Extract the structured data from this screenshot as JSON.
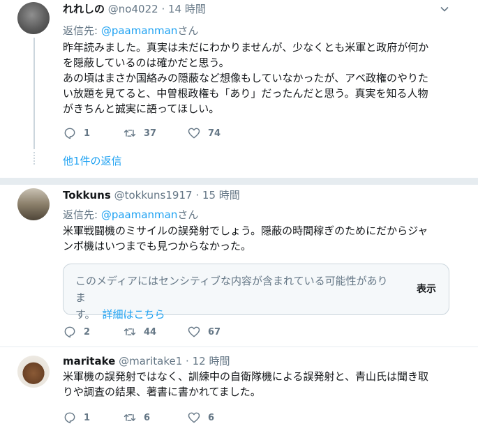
{
  "tweets": [
    {
      "name": "れれしの",
      "handle": "@no4022",
      "separator": "·",
      "time": "14 時間",
      "reply_prefix": "返信先: ",
      "reply_mention": "@paamanman",
      "reply_suffix": "さん",
      "lines": [
        "昨年読みました。真実は未だにわかりませんが、少なくとも米軍と政府が何か",
        "を隠蔽しているのは確かだと思う。",
        "あの頃はまさか国絡みの隠蔽など想像もしていなかったが、アベ政権のやりた",
        "い放題を見てると、中曽根政権も「あり」だったんだと思う。真実を知る人物",
        "がきちんと誠実に語ってほしい。"
      ],
      "replies": "1",
      "retweets": "37",
      "likes": "74",
      "more_replies": "他1件の返信"
    },
    {
      "name": "Tokkuns",
      "handle": "@tokkuns1917",
      "separator": "·",
      "time": "15 時間",
      "reply_prefix": "返信先: ",
      "reply_mention": "@paamanman",
      "reply_suffix": "さん",
      "lines": [
        "米軍戦闘機のミサイルの誤発射でしょう。隠蔽の時間稼ぎのためにだからジャ",
        "ンボ機はいつまでも見つからなかった。"
      ],
      "sensitive": {
        "line1": "このメディアにはセンシティブな内容が含まれている可能性がありま",
        "line2": "す。",
        "link": "詳細はこちら",
        "show": "表示"
      },
      "replies": "2",
      "retweets": "44",
      "likes": "67"
    },
    {
      "name": "maritake",
      "handle": "@maritake1",
      "separator": "·",
      "time": "12 時間",
      "lines": [
        "米軍機の誤発射ではなく、訓練中の自衛隊機による誤発射と、青山氏は聞き取",
        "りや調査の結果、著書に書かれてました。"
      ],
      "replies": "1",
      "retweets": "6",
      "likes": "6"
    }
  ],
  "icons": {
    "reply": "reply-icon",
    "retweet": "retweet-icon",
    "like": "heart-icon",
    "menu": "chevron-down-icon"
  },
  "colors": {
    "accent": "#1da1f2",
    "muted": "#657786",
    "divider": "#e6ecf0"
  }
}
